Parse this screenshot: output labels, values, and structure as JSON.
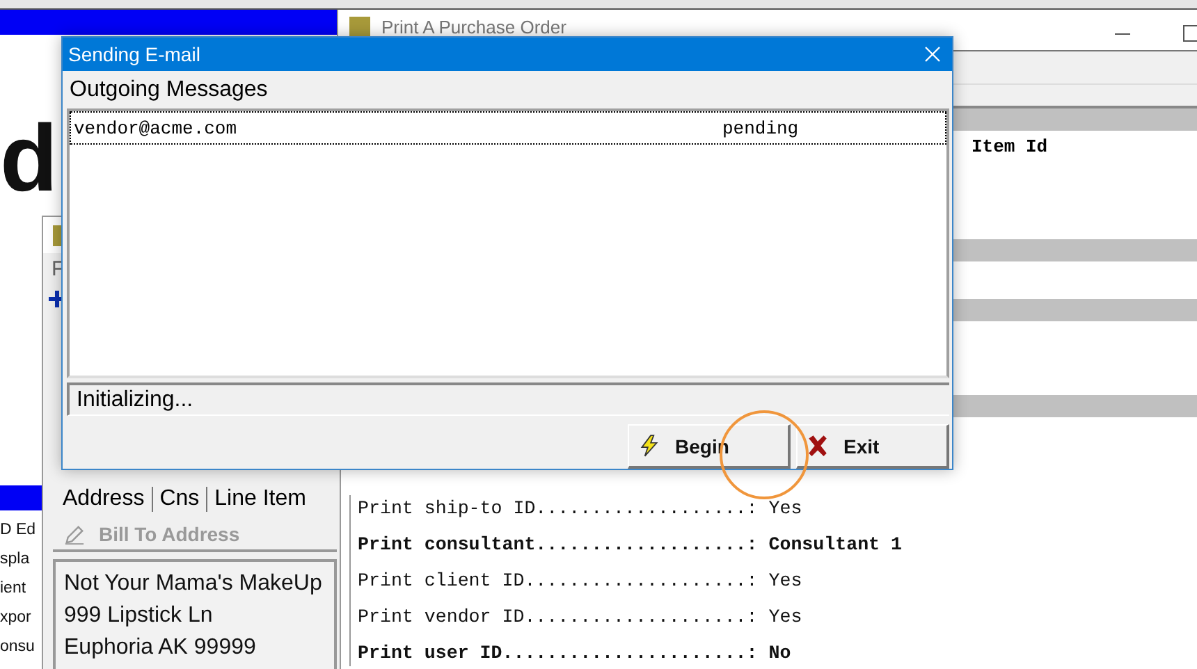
{
  "background": {
    "letter": "d",
    "fragments": [
      "D Ed",
      "spla",
      "ient",
      "xpor",
      "onsu"
    ]
  },
  "order_window": {
    "title": "Print A Purchase Order",
    "column_header": "Item Id",
    "report_lines": [
      {
        "text": "Print ship-to ID...................: Yes",
        "bold": false
      },
      {
        "text": "Print consultant...................: Consultant 1",
        "bold": true
      },
      {
        "text": "Print client ID....................: Yes",
        "bold": false
      },
      {
        "text": "Print vendor ID....................: Yes",
        "bold": false
      },
      {
        "text": "Print user ID......................: No",
        "bold": true
      }
    ]
  },
  "address_window": {
    "menu_letter": "F",
    "tabs": [
      "Address",
      "Cns",
      "Line Item"
    ],
    "button": {
      "label": "Bill To Address",
      "disabled": true
    },
    "address_lines": [
      "Not Your Mama's MakeUp",
      "999 Lipstick Ln",
      "Euphoria  AK   99999"
    ]
  },
  "dialog": {
    "title": "Sending E-mail",
    "list_label": "Outgoing Messages",
    "messages": [
      {
        "recipient": "vendor@acme.com",
        "status": "pending",
        "selected": true
      }
    ],
    "status_text": "Initializing...",
    "buttons": [
      {
        "kind": "begin",
        "label": "Begin"
      },
      {
        "kind": "exit",
        "label": "Exit"
      }
    ]
  }
}
